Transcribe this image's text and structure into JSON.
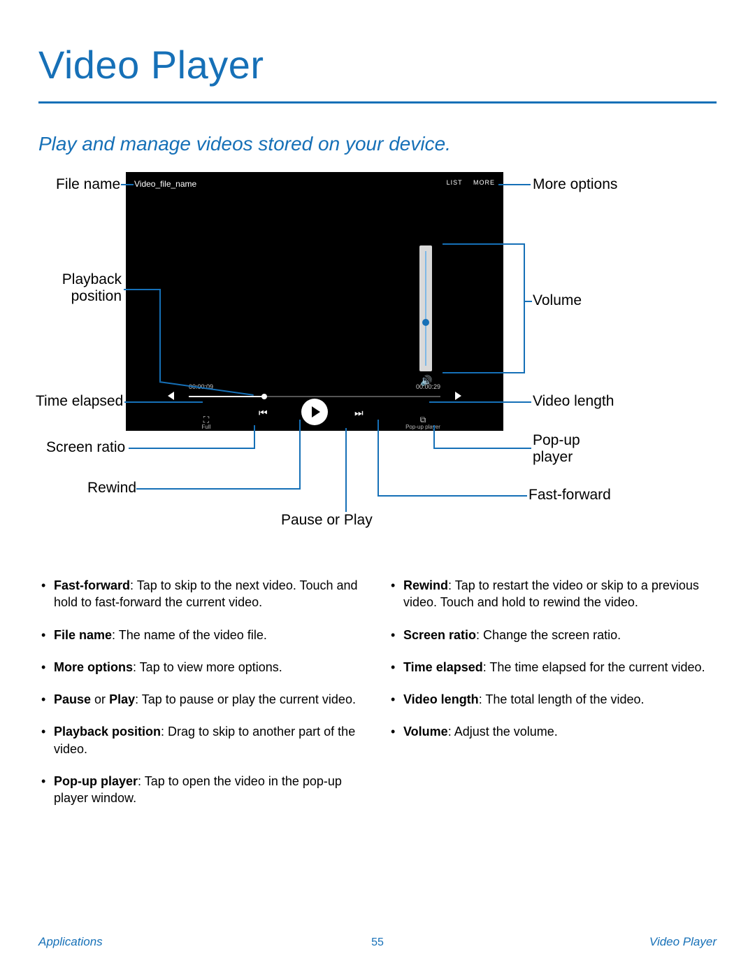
{
  "page": {
    "title": "Video Player",
    "subtitle": "Play and manage videos stored on your device.",
    "footer_left": "Applications",
    "footer_center": "55",
    "footer_right": "Video Player"
  },
  "player": {
    "file_name": "Video_file_name",
    "list_label": "LIST",
    "more_label": "MORE",
    "time_elapsed": "00:00:09",
    "time_total": "00:00:29",
    "full_label": "Full",
    "popup_label": "Pop-up player"
  },
  "callouts": {
    "file_name": "File name",
    "more_options": "More options",
    "playback_position": "Playback\nposition",
    "volume": "Volume",
    "time_elapsed": "Time elapsed",
    "video_length": "Video length",
    "screen_ratio": "Screen ratio",
    "popup_player": "Pop-up\nplayer",
    "rewind": "Rewind",
    "fast_forward": "Fast-forward",
    "pause_play": "Pause or Play"
  },
  "bullets_left": [
    {
      "term": "Fast-forward",
      "text": ": Tap to skip to the next video. Touch and hold to fast-forward the current video."
    },
    {
      "term": "File name",
      "text": ": The name of the video file."
    },
    {
      "term": "More options",
      "text": ": Tap to view more options."
    },
    {
      "term": "Pause or Play",
      "term2_or": " or ",
      "term2": "Play",
      "text_pre": "Pause",
      "text": ": Tap to pause or play the current video.",
      "is_pause_play": true
    },
    {
      "term": "Playback position",
      "text": ": Drag to skip to another part of the video."
    },
    {
      "term": "Pop-up player",
      "text": ": Tap to open the video in the pop-up player window."
    }
  ],
  "bullets_right": [
    {
      "term": "Rewind",
      "text": ": Tap to restart the video or skip to a previous video. Touch and hold to rewind the video."
    },
    {
      "term": "Screen ratio",
      "text": ": Change the screen ratio."
    },
    {
      "term": "Time elapsed",
      "text": ": The time elapsed for the current video."
    },
    {
      "term": "Video length",
      "text": ": The total length of the video."
    },
    {
      "term": "Volume",
      "text": ": Adjust the volume."
    }
  ]
}
